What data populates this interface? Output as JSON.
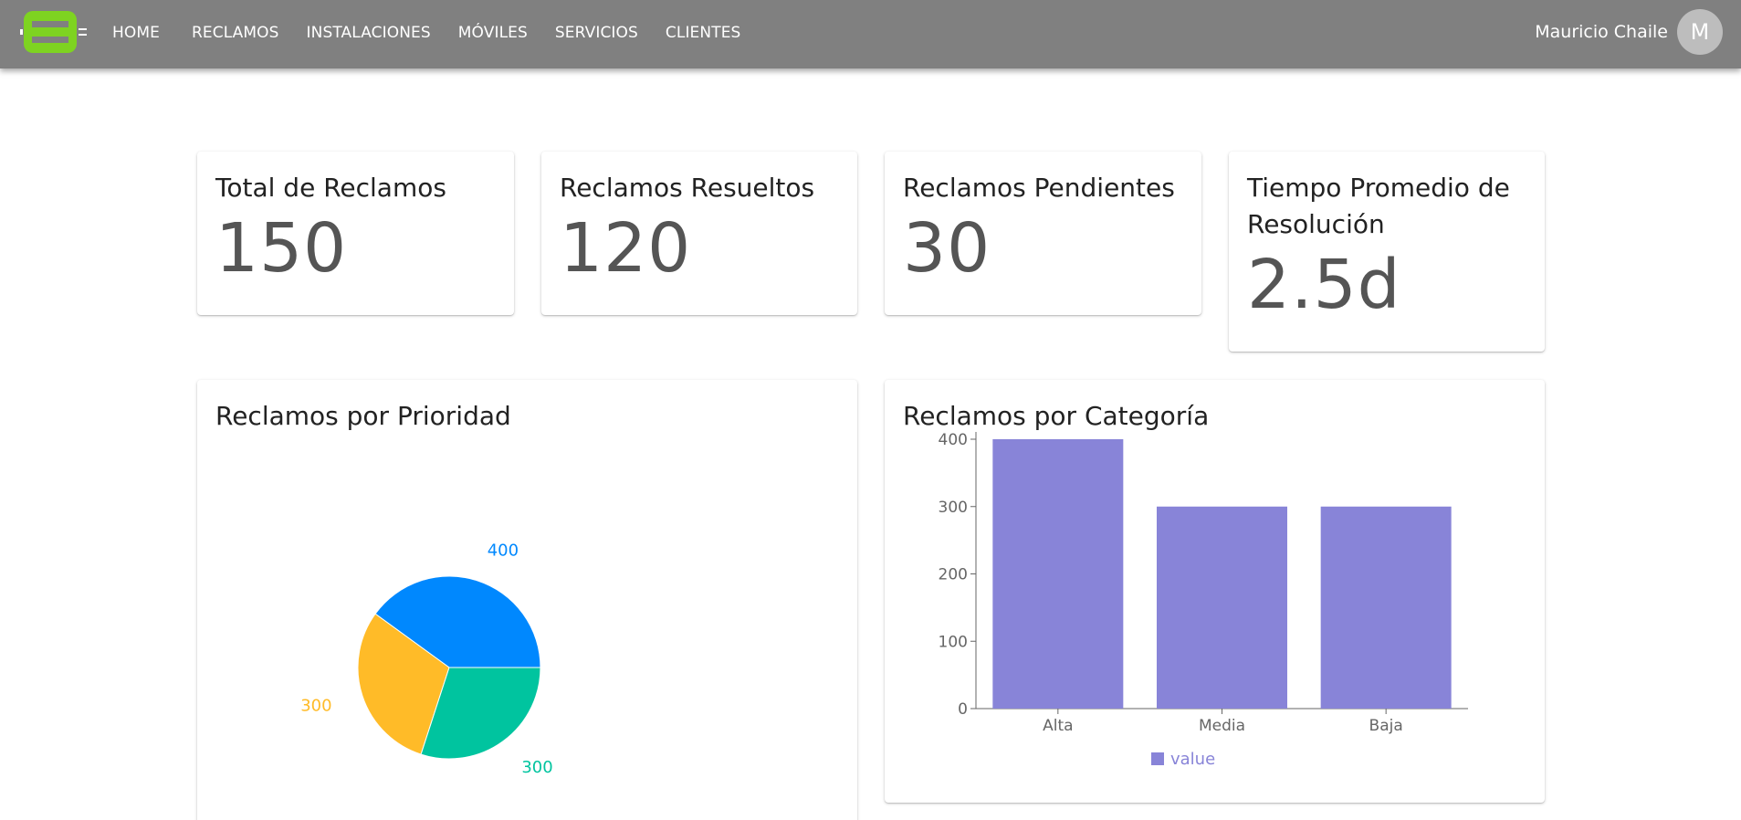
{
  "header": {
    "nav": [
      {
        "label": "HOME"
      },
      {
        "label": "RECLAMOS"
      },
      {
        "label": "INSTALACIONES"
      },
      {
        "label": "MÓVILES"
      },
      {
        "label": "SERVICIOS"
      },
      {
        "label": "CLIENTES"
      }
    ],
    "user_name": "Mauricio Chaile",
    "avatar_initial": "M",
    "logo_icon": "logo-icon",
    "logo_color": "#7ed321"
  },
  "stats": [
    {
      "title": "Total de Reclamos",
      "value": "150"
    },
    {
      "title": "Reclamos Resueltos",
      "value": "120"
    },
    {
      "title": "Reclamos Pendientes",
      "value": "30"
    },
    {
      "title": "Tiempo Promedio de Resolución",
      "value": "2.5d"
    }
  ],
  "charts": {
    "priority_title": "Reclamos por Prioridad",
    "category_title": "Reclamos por Categoría"
  },
  "chart_data": [
    {
      "type": "pie",
      "title": "Reclamos por Prioridad",
      "values": [
        400,
        300,
        300
      ],
      "colors": [
        "#0088fe",
        "#ffbb28",
        "#00c49f"
      ],
      "labels": [
        "400",
        "300",
        "300"
      ]
    },
    {
      "type": "bar",
      "title": "Reclamos por Categoría",
      "categories": [
        "Alta",
        "Media",
        "Baja"
      ],
      "series": [
        {
          "name": "value",
          "values": [
            400,
            300,
            300
          ]
        }
      ],
      "yticks": [
        "0",
        "100",
        "200",
        "300",
        "400"
      ],
      "ylim": [
        0,
        400
      ],
      "legend": "bottom",
      "color": "#8884d8"
    }
  ]
}
